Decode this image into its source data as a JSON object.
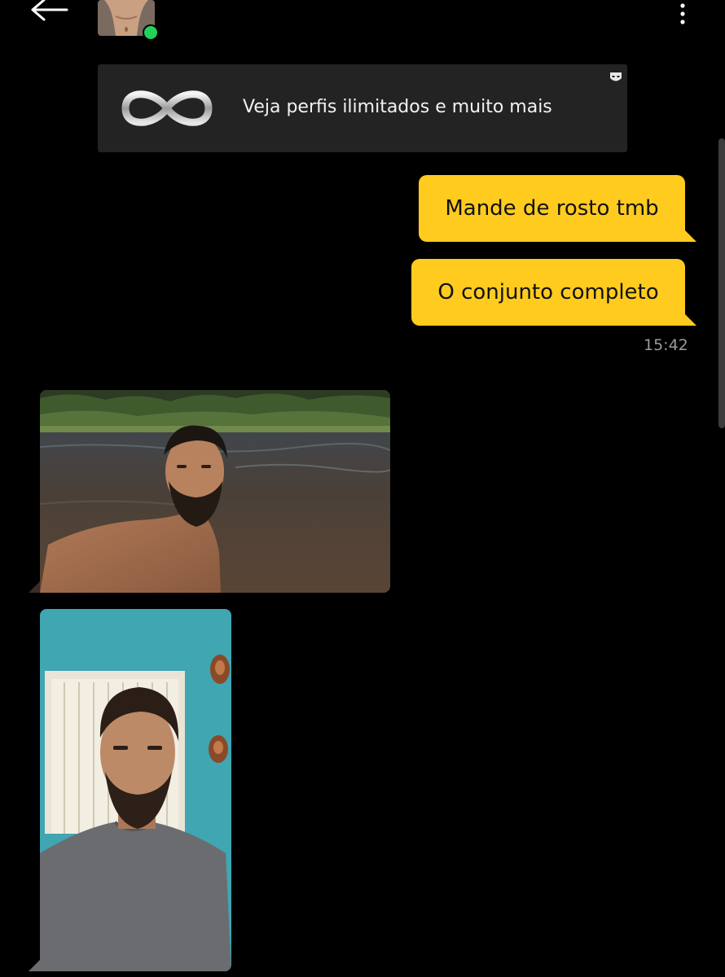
{
  "header": {
    "back_icon": "arrow-left-icon",
    "avatar_icon": "profile-photo",
    "online_status_color": "#22d15b",
    "more_icon": "more-vertical-icon"
  },
  "banner": {
    "icon": "infinity-icon",
    "text": "Veja perfis ilimitados e muito mais",
    "corner_icon": "mask-icon"
  },
  "messages": {
    "sent": [
      {
        "text": "Mande de rosto tmb"
      },
      {
        "text": "O conjunto completo"
      }
    ],
    "timestamp": "15:42",
    "received_photos": [
      {
        "icon": "photo-river-selfie"
      },
      {
        "icon": "photo-room-selfie"
      }
    ]
  },
  "colors": {
    "background": "#000000",
    "bubble": "#ffcb1f",
    "banner": "#232323"
  }
}
